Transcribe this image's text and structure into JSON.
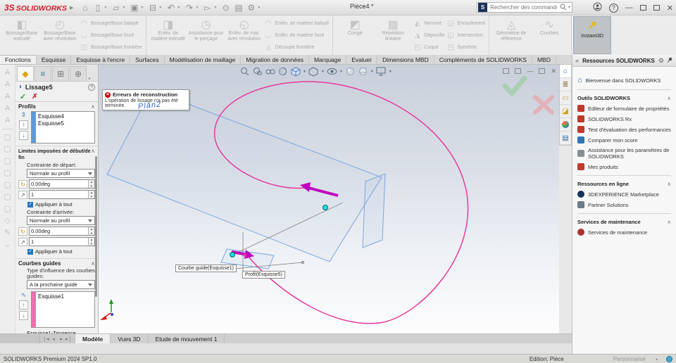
{
  "titlebar": {
    "brand_prefix": "3S",
    "brand": "SOLIDWORKS",
    "doc_title": "Pièce4 *",
    "search_placeholder": "Rechercher des commandes"
  },
  "ribbon": {
    "g1_big": [
      "Bossage/Base extrudé",
      "Bossage/Base avec révolution"
    ],
    "g1_small": [
      "Bossage/Base balayé",
      "Bossage/Base lissé",
      "Bossage/Base frontière"
    ],
    "g2_big": [
      "Enlèv. de matière extrudé",
      "Assistance pour le perçage",
      "Enlèv. de mat. avec révolution"
    ],
    "g2_small": [
      "Enlèv. de matière balayé",
      "Enlèv. de matière lissé",
      "Découpe frontière"
    ],
    "g3_big": [
      "Congé",
      "Répétition linéaire"
    ],
    "g3_small_a": [
      "Nervure",
      "Dépouille",
      "Coque"
    ],
    "g3_small_b": [
      "Enroulement",
      "Intersection",
      "Symétrie"
    ],
    "g4_big": [
      "Géométrie de référence",
      "Courbes"
    ],
    "instant3d": "Instant3D"
  },
  "tabs": [
    "Fonctions",
    "Esquisse",
    "Esquisse à l'encre",
    "Surfaces",
    "Modélisation de maillage",
    "Migration de données",
    "Marquage",
    "Evaluer",
    "Dimensions MBD",
    "Compléments de SOLIDWORKS",
    "MBD"
  ],
  "pm": {
    "title": "Lissage5",
    "profils": {
      "header": "Profils",
      "items": [
        "Esquisse4",
        "Esquisse5"
      ]
    },
    "limits": {
      "header": "Limites imposées de début/de fin",
      "start_label": "Contrainte de départ:",
      "start_value": "Normale au profil",
      "angle1": "0.00deg",
      "factor1": "1",
      "apply1": "Appliquer à tout",
      "end_label": "Contrainte d'arrivée:",
      "end_value": "Normale au profil",
      "angle2": "0.00deg",
      "factor2": "1",
      "apply2": "Appliquer à tout"
    },
    "guides": {
      "header": "Courbes guides",
      "influence_label": "Type d'influence des courbes guides:",
      "influence_value": "A la prochaine guide",
      "items": [
        "Esquisse1"
      ],
      "tangence": "Esquisse1-Tangence"
    }
  },
  "viewport": {
    "error_title": "Erreurs de reconstruction",
    "error_text": "L'opération de lissage n'a pas été terminée.",
    "plane_label": "Plan2",
    "callout_guide": "Courbe guide(Esquisse1)",
    "callout_profile": "Profil(Esquisse5)"
  },
  "taskpane": {
    "title": "Ressources SOLIDWORKS",
    "welcome": "Bienvenue dans SOLIDWORKS",
    "sections": [
      {
        "header": "Outils SOLIDWORKS",
        "items": [
          "Editeur de formulaire de propriétés",
          "SOLIDWORKS Rx",
          "Test d'évaluation des performances",
          "Comparer mon score",
          "Assistance pour les paramètres de SOLIDWORKS",
          "Mes produits"
        ]
      },
      {
        "header": "Ressources en ligne",
        "items": [
          "3DEXPERIENCE Marketplace",
          "Partner Solutions"
        ]
      },
      {
        "header": "Services de maintenance",
        "items": [
          "Services de maintenance"
        ]
      }
    ]
  },
  "bottom_tabs": [
    "Modèle",
    "Vues 3D",
    "Etude de mouvement 1"
  ],
  "statusbar": {
    "left": "SOLIDWORKS Premium 2024 SP1.0",
    "mode": "Edition: Pièce",
    "custom": "Personnalisé"
  },
  "colors": {
    "brand_red": "#d21e2b",
    "guide_magenta": "#e83a9e",
    "selection_magenta": "#c000c0",
    "point_cyan": "#17e0e0",
    "plane_blue": "#7aa7e0",
    "profile_bar_blue": "#5b9bd5",
    "guide_bar_pink": "#ef6fb0",
    "error_red": "#c00000"
  }
}
